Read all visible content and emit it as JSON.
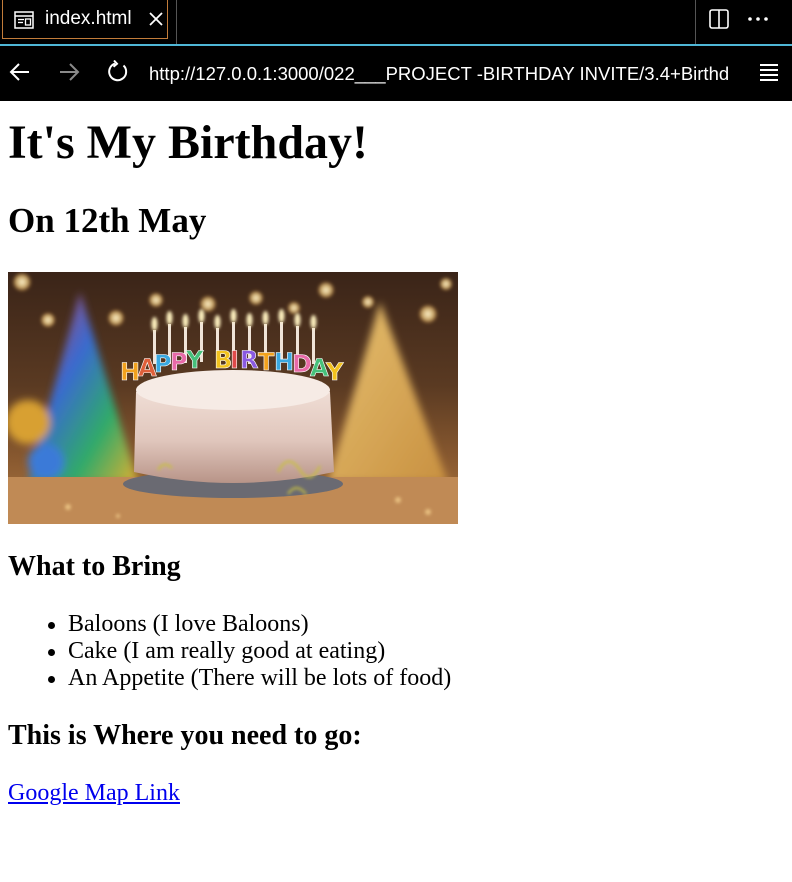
{
  "browser": {
    "tab": {
      "title": "index.html"
    },
    "address_bar": {
      "url": "http://127.0.0.1:3000/022___PROJECT -BIRTHDAY INVITE/3.4+Birthd"
    }
  },
  "page": {
    "heading": "It's My Birthday!",
    "date": "On 12th May",
    "image": {
      "alt": "birthday cake",
      "candle_letters": "HAPPY BIRTHDAY"
    },
    "bring_heading": "What to Bring",
    "bring_items": [
      "Baloons (I love Baloons)",
      "Cake (I am really good at eating)",
      "An Appetite (There will be lots of food)"
    ],
    "where_heading": "This is Where you need to go:",
    "map_link": "Google Map Link"
  },
  "icons": [
    "page-icon",
    "close-icon",
    "split-editor-icon",
    "more-icon",
    "back-arrow-icon",
    "forward-arrow-icon",
    "reload-icon",
    "menu-icon"
  ],
  "colors": {
    "chrome_bg": "#000000",
    "tab_border": "#c27c3a",
    "chrome_divider": "#4fb7d6",
    "link": "#0000ee"
  }
}
